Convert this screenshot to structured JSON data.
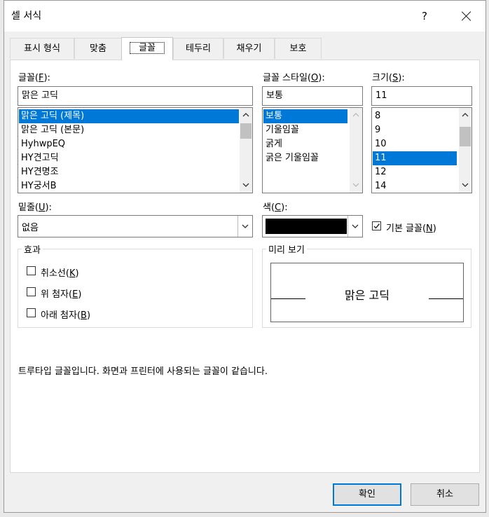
{
  "window": {
    "title": "셀 서식",
    "help": "?"
  },
  "tabs": [
    {
      "label": "표시 형식"
    },
    {
      "label": "맞춤"
    },
    {
      "label": "글꼴"
    },
    {
      "label": "테두리"
    },
    {
      "label": "채우기"
    },
    {
      "label": "보호"
    }
  ],
  "font": {
    "label": "글꼴(",
    "key": "F",
    "label_end": "):",
    "value": "맑은 고딕",
    "items": [
      "맑은 고딕 (제목)",
      "맑은 고딕 (본문)",
      "HyhwpEQ",
      "HY견고딕",
      "HY견명조",
      "HY궁서B"
    ],
    "selected": "맑은 고딕 (제목)"
  },
  "style": {
    "label": "글꼴 스타일(",
    "key": "O",
    "label_end": "):",
    "value": "보통",
    "items": [
      "보통",
      "기울임꼴",
      "굵게",
      "굵은 기울임꼴"
    ],
    "selected": "보통"
  },
  "size": {
    "label": "크기(",
    "key": "S",
    "label_end": "):",
    "value": "11",
    "items": [
      "8",
      "9",
      "10",
      "11",
      "12",
      "14"
    ],
    "selected": "11"
  },
  "underline": {
    "label": "밑줄(",
    "key": "U",
    "label_end": "):",
    "value": "없음"
  },
  "color": {
    "label": "색(",
    "key": "C",
    "label_end": "):",
    "swatch": "#000000"
  },
  "normal_font": {
    "label": "기본 글꼴(",
    "key": "N",
    "label_end": ")",
    "checked": true
  },
  "effects": {
    "title": "효과",
    "strike": {
      "label": "취소선(",
      "key": "K",
      "end": ")",
      "checked": false
    },
    "superscript": {
      "label": "위 첨자(",
      "key": "E",
      "end": ")",
      "checked": false
    },
    "subscript": {
      "label": "아래 첨자(",
      "key": "B",
      "end": ")",
      "checked": false
    }
  },
  "preview": {
    "title": "미리 보기",
    "sample": "맑은 고딕"
  },
  "info": "트루타입 글꼴입니다. 화면과 프린터에 사용되는 글꼴이 같습니다.",
  "buttons": {
    "ok": "확인",
    "cancel": "취소"
  },
  "colors": {
    "accent": "#0078d7",
    "selection": "#0078d7"
  }
}
